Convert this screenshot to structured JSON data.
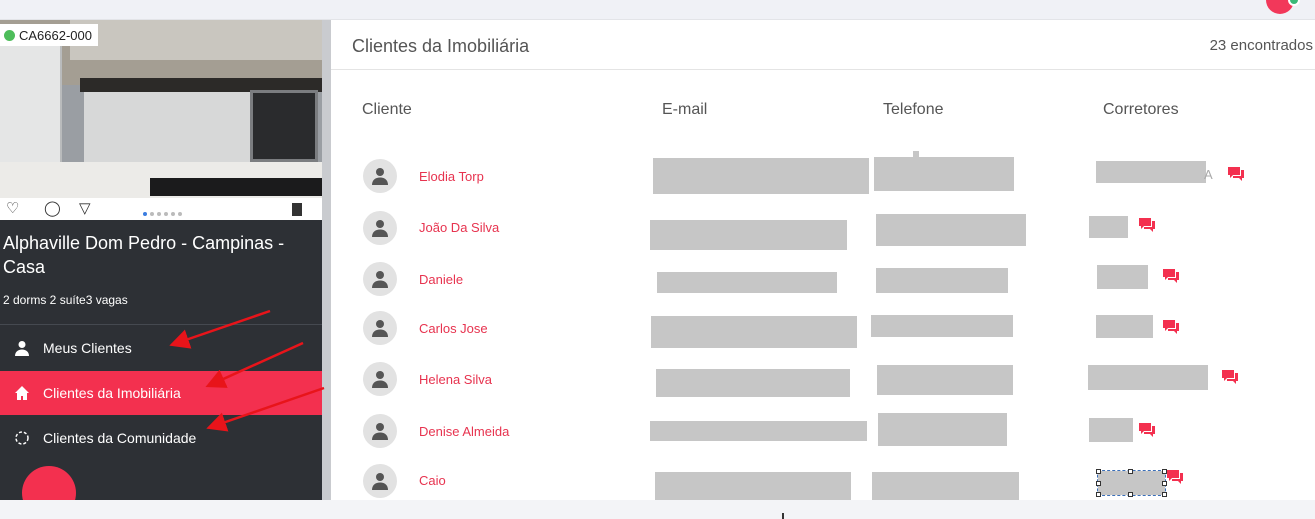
{
  "property": {
    "code": "CA6662-000",
    "title": "Alphaville Dom Pedro - Campinas - Casa",
    "features": "2 dorms 2 suíte3 vagas",
    "actions": {
      "like_icon": "heart-icon",
      "comment_icon": "comment-icon",
      "share_icon": "send-icon",
      "save_icon": "bookmark-icon"
    }
  },
  "menu": {
    "items": [
      {
        "label": "Meus Clientes",
        "icon": "user-icon"
      },
      {
        "label": "Clientes da Imobiliária",
        "icon": "home-icon",
        "active": true
      },
      {
        "label": "Clientes da Comunidade",
        "icon": "community-icon"
      }
    ]
  },
  "main": {
    "title": "Clientes da Imobiliária",
    "count": "23 encontrados",
    "columns": [
      "Cliente",
      "E-mail",
      "Telefone",
      "Corretores"
    ],
    "rows": [
      {
        "name": "Elodia Torp",
        "corretor_suffix": "A"
      },
      {
        "name": "João Da Silva"
      },
      {
        "name": "Daniele"
      },
      {
        "name": "Carlos Jose"
      },
      {
        "name": "Helena Silva"
      },
      {
        "name": "Denise Almeida"
      },
      {
        "name": "Caio"
      }
    ]
  },
  "colors": {
    "accent": "#f3304f",
    "sidebar": "#2d3035",
    "link": "#e7334f"
  }
}
